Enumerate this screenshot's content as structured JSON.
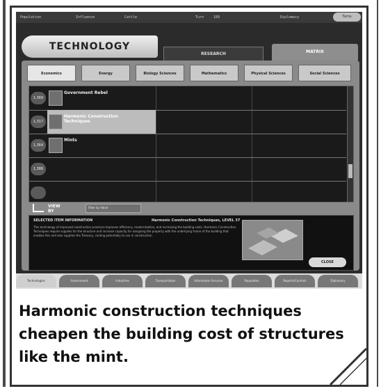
{
  "topbar": {
    "seg1": "Population",
    "seg2": "Influence",
    "seg3": "Cattle",
    "seg4": "Turn",
    "seg4_value": "189",
    "seg5": "Diplomacy",
    "button": "Turns"
  },
  "header": {
    "technology_tab": "TECHNOLOGY",
    "research_tab": "RESEARCH",
    "matrix_tab": "MATRIX"
  },
  "categories": [
    "Economics",
    "Energy",
    "Biology Sciences",
    "Mathematics",
    "Physical Sciences",
    "Social Sciences"
  ],
  "rows": [
    {
      "num": "1,369",
      "name": "Government Rebel"
    },
    {
      "num": "1,317",
      "name": "Harmonic Construction Techniques"
    },
    {
      "num": "1,364",
      "name": "Mints"
    },
    {
      "num": "1,386",
      "name": ""
    },
    {
      "num": "",
      "name": ""
    }
  ],
  "listctrl": {
    "label": "VIEW BY",
    "select_value": "Filter by Value"
  },
  "info": {
    "title": "SELECTED ITEM INFORMATION",
    "right_title": "Harmonic Construction Techniques, LEVEL 37",
    "description": "This technology of improved construction practices improves efficiency, modernization, and increasing the building costs. Harmonic Construction Techniques require supplies for the structure and increase capacity for assigning the property with the underlying frame of the building that enables this and also supplies the Treasury, costing potentially to use in construction."
  },
  "close_button": "CLOSE",
  "bottom_tabs": [
    "Technologies",
    "Government",
    "Industries",
    "Transportation",
    "Information Services",
    "Population",
    "Reports/Controls",
    "Diplomacy"
  ],
  "caption": "Harmonic construction techniques cheapen the building cost of structures like the mint."
}
